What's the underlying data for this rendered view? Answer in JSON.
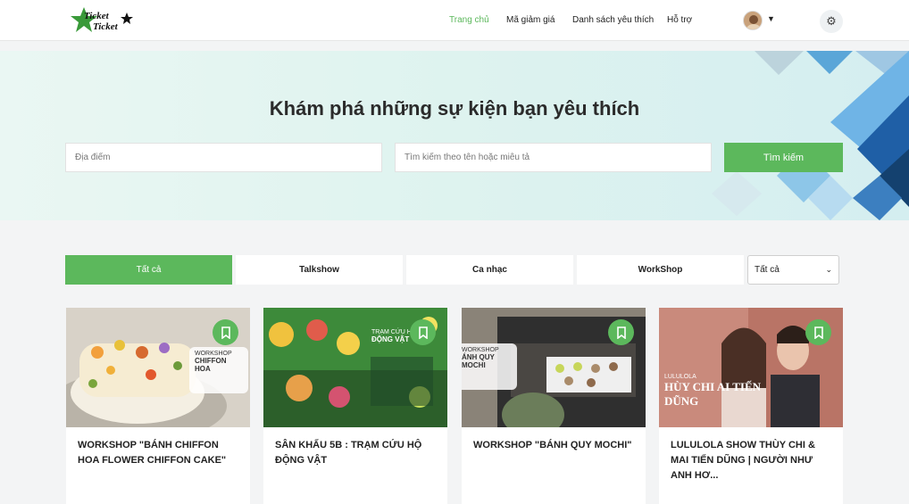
{
  "header": {
    "logo_text": "Ticket Ticket",
    "nav": [
      {
        "label": "Trang chủ",
        "active": true
      },
      {
        "label": "Mã giảm giá",
        "active": false
      },
      {
        "label": "Danh sách yêu thích",
        "active": false
      },
      {
        "label": "Hỗ trợ",
        "active": false
      }
    ],
    "settings_icon": "gear-icon"
  },
  "hero": {
    "title": "Khám phá những sự kiện bạn yêu thích",
    "location_placeholder": "Địa điểm",
    "search_placeholder": "Tìm kiếm theo tên hoặc miêu tả",
    "search_button": "Tìm kiếm"
  },
  "tabs": [
    {
      "label": "Tất cả",
      "active": true
    },
    {
      "label": "Talkshow",
      "active": false
    },
    {
      "label": "Ca nhạc",
      "active": false
    },
    {
      "label": "WorkShop",
      "active": false
    }
  ],
  "filter": {
    "selected": "Tất cả"
  },
  "events": [
    {
      "title": "WORKSHOP \"BÁNH CHIFFON HOA FLOWER CHIFFON CAKE\"",
      "image_label_top": "WORKSHOP",
      "image_label_main": "CHIFFON HOA"
    },
    {
      "title": "SÂN KHẤU 5B : TRẠM CỨU HỘ ĐỘNG VẬT",
      "image_label_top": "TRẠM CỨU HỘ",
      "image_label_main": "ĐỘNG VẬT"
    },
    {
      "title": "WORKSHOP \"BÁNH QUY MOCHI\"",
      "image_label_top": "WORKSHOP",
      "image_label_main": "ÁNH QUY MOCHI"
    },
    {
      "title": "LULULOLA SHOW THÙY CHI & MAI TIẾN DŨNG | NGƯỜI NHƯ ANH HƠ...",
      "image_label_top": "LULULOLA",
      "image_label_main": "HÙY CHI  AI TIẾN DŨNG"
    }
  ],
  "colors": {
    "accent": "#5cb85c",
    "hero_bg": "#def3ef",
    "deco_blue": "#2a78c8"
  }
}
